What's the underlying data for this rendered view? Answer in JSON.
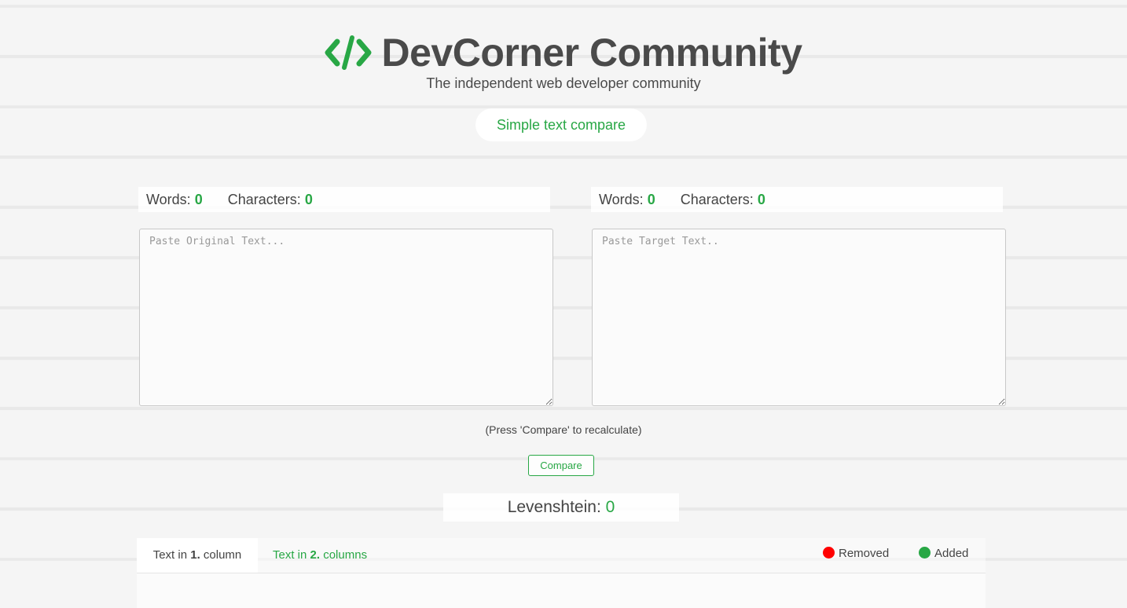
{
  "header": {
    "logo_icon": "code-brackets-icon",
    "brand_color": "#28a745",
    "title": "DevCorner Community",
    "tagline": "The independent web developer community"
  },
  "mode": {
    "label": "Simple text compare"
  },
  "original": {
    "words_label": "Words:",
    "words": "0",
    "chars_label": "Characters:",
    "chars": "0",
    "placeholder": "Paste Original Text...",
    "value": ""
  },
  "target": {
    "words_label": "Words:",
    "words": "0",
    "chars_label": "Characters:",
    "chars": "0",
    "placeholder": "Paste Target Text..",
    "value": ""
  },
  "hint": "(Press 'Compare' to recalculate)",
  "compare_button": "Compare",
  "levenshtein": {
    "label": "Levenshtein:",
    "value": "0"
  },
  "tabs": [
    {
      "prefix": "Text in ",
      "num": "1.",
      "suffix": " column",
      "active": true
    },
    {
      "prefix": "Text in ",
      "num": "2.",
      "suffix": " columns",
      "active": false
    }
  ],
  "legend": {
    "removed": {
      "label": "Removed",
      "color": "#ff0000"
    },
    "added": {
      "label": "Added",
      "color": "#28a745"
    }
  }
}
